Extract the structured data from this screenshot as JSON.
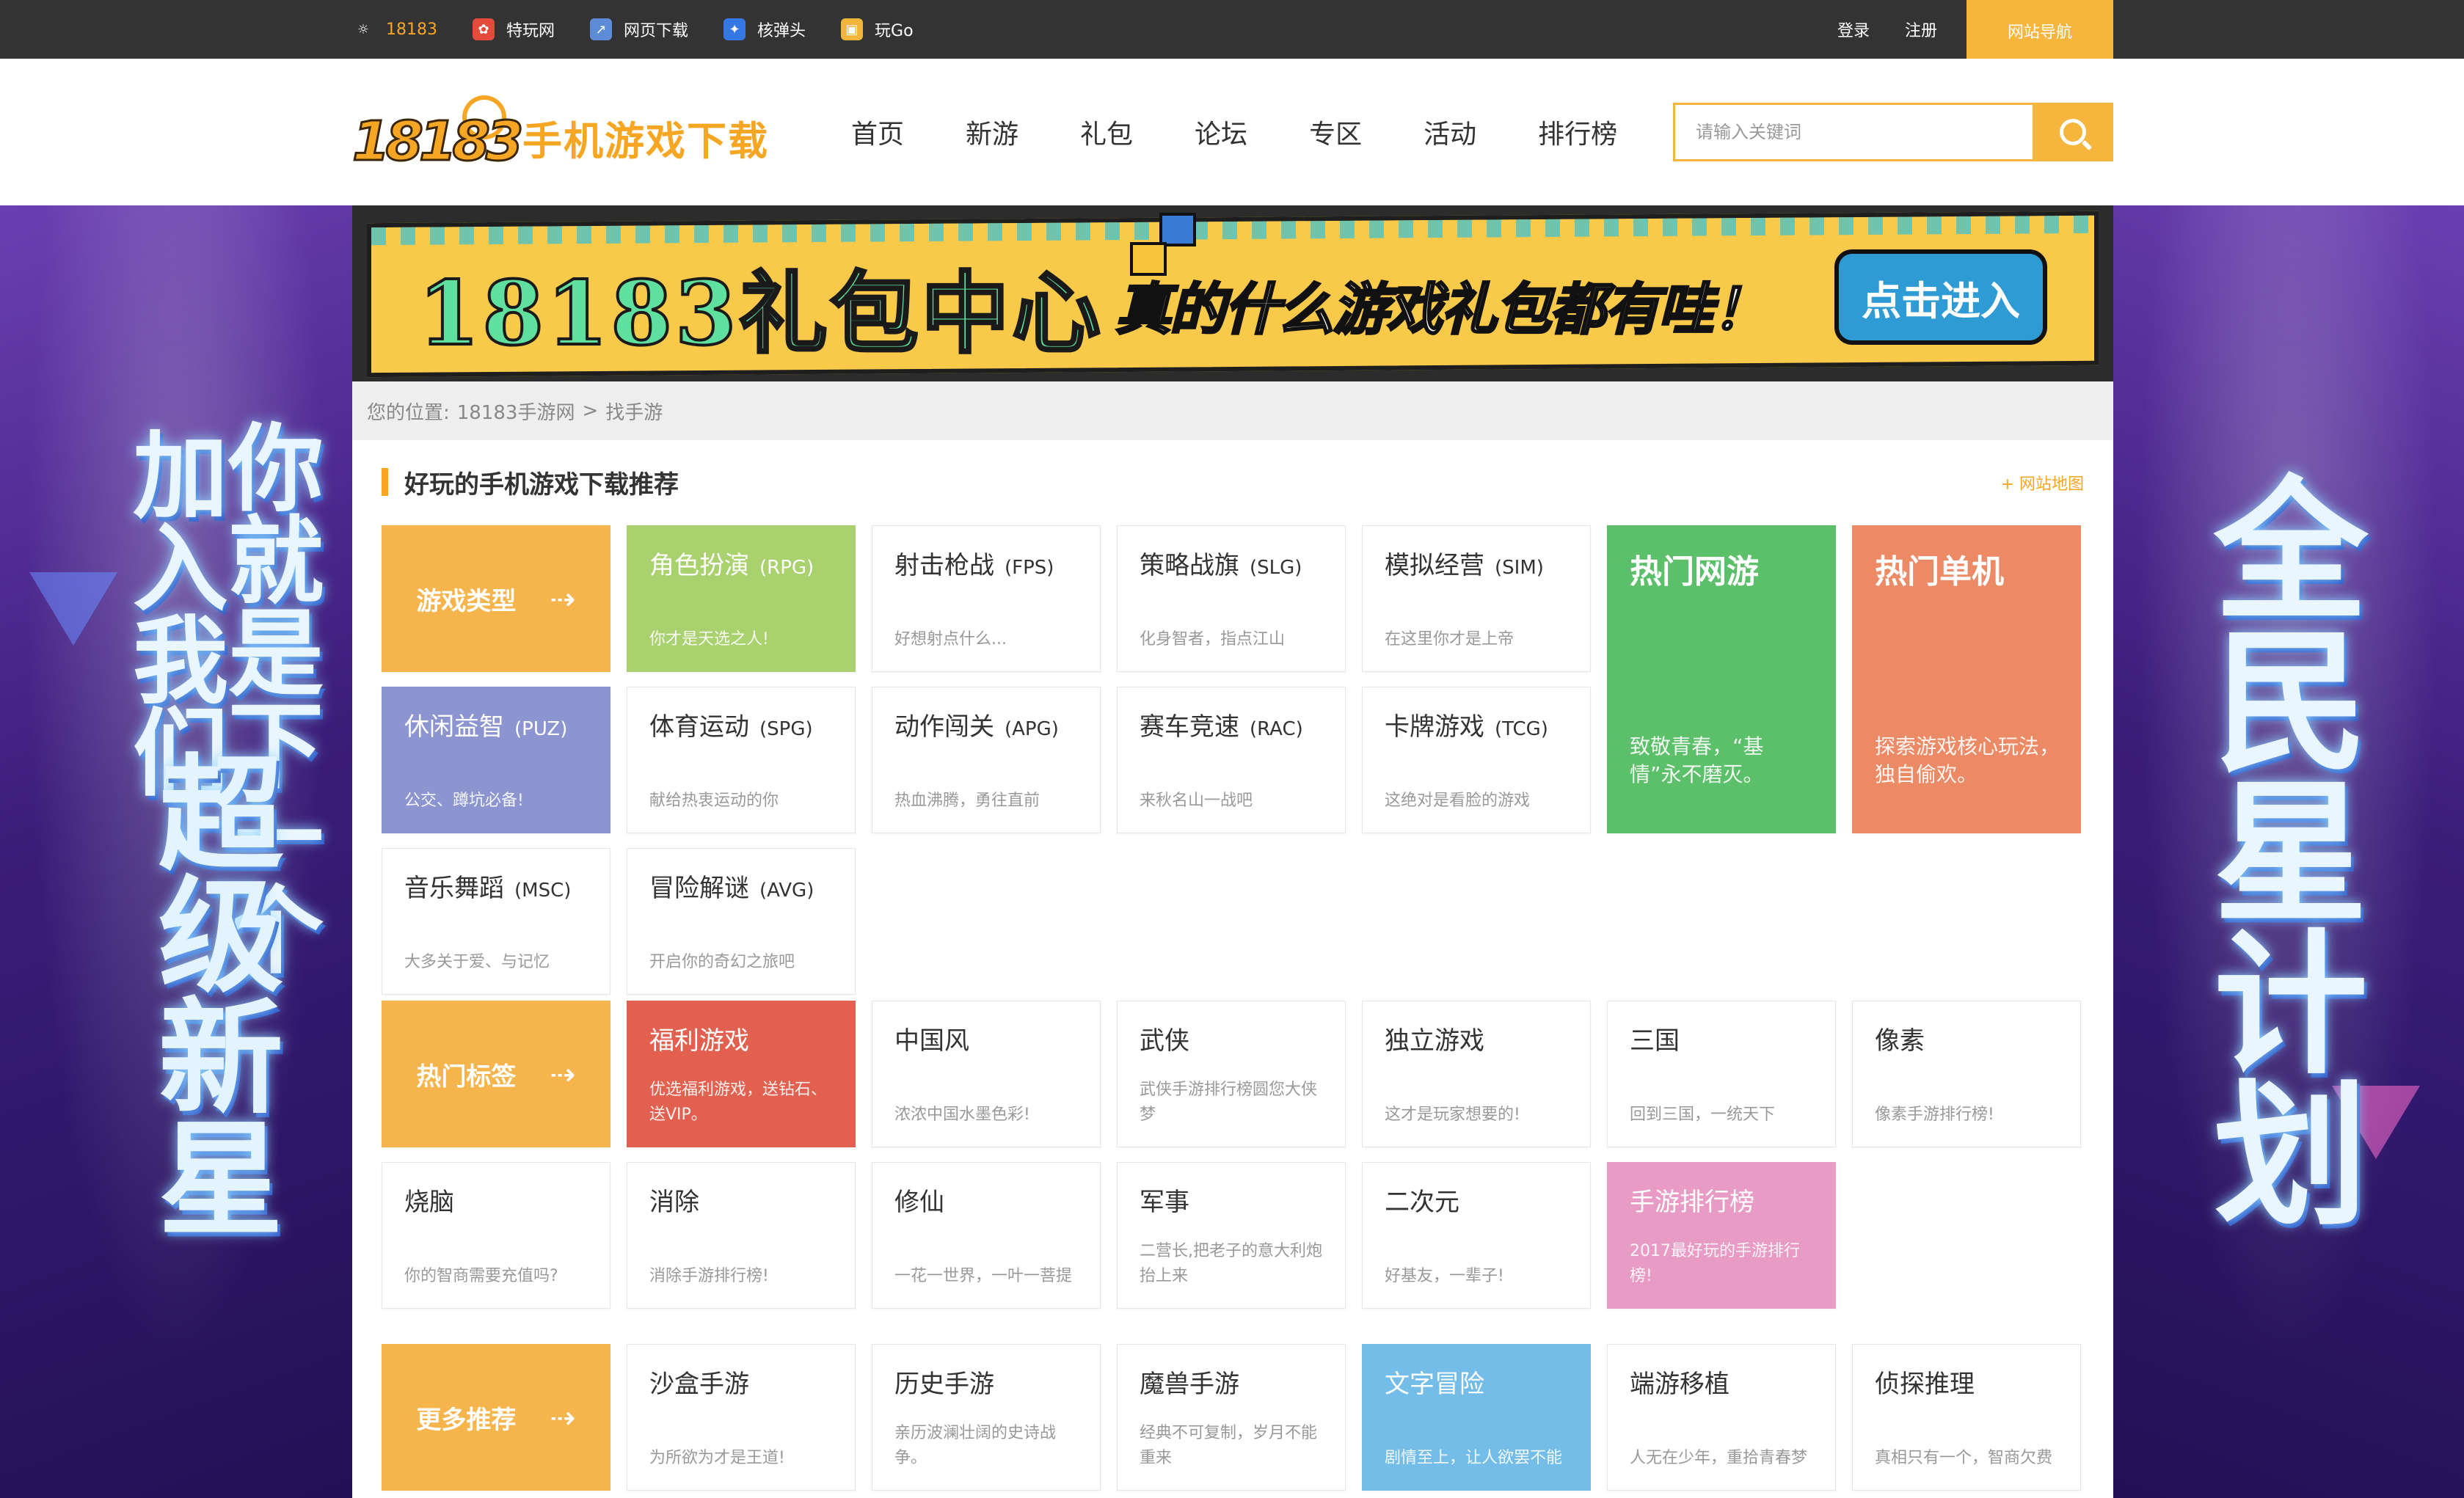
{
  "topbar": {
    "links": [
      {
        "label": "18183",
        "icon": "sun-logo-icon"
      },
      {
        "label": "特玩网",
        "icon": "tewan-icon"
      },
      {
        "label": "网页下载",
        "icon": "webpage-download-icon"
      },
      {
        "label": "核弹头",
        "icon": "hedantou-icon"
      },
      {
        "label": "玩Go",
        "icon": "wango-icon"
      }
    ],
    "login": "登录",
    "register": "注册",
    "site_nav": "网站导航"
  },
  "header": {
    "logo_text": "18183",
    "title": "手机游戏下载",
    "nav": [
      "首页",
      "新游",
      "礼包",
      "论坛",
      "专区",
      "活动",
      "排行榜"
    ],
    "search_placeholder": "请输入关键词"
  },
  "banner": {
    "title": "18183礼包中心",
    "subtitle": "真的什么游戏礼包都有哇！",
    "button": "点击进入"
  },
  "breadcrumb": {
    "prefix": "您的位置:",
    "items": [
      "18183手游网",
      ">",
      "找手游"
    ]
  },
  "section": {
    "title": "好玩的手机游戏下载推荐",
    "sitemap": "+ 网站地图"
  },
  "game_types": {
    "header": "游戏类型",
    "items": [
      {
        "name": "角色扮演",
        "abbr": "(RPG)",
        "desc": "你才是天选之人!"
      },
      {
        "name": "射击枪战",
        "abbr": "(FPS)",
        "desc": "好想射点什么..."
      },
      {
        "name": "策略战旗",
        "abbr": "(SLG)",
        "desc": "化身智者，指点江山"
      },
      {
        "name": "模拟经营",
        "abbr": "(SIM)",
        "desc": "在这里你才是上帝"
      },
      {
        "name": "休闲益智",
        "abbr": "(PUZ)",
        "desc": "公交、蹲坑必备!"
      },
      {
        "name": "体育运动",
        "abbr": "(SPG)",
        "desc": "献给热衷运动的你"
      },
      {
        "name": "动作闯关",
        "abbr": "(APG)",
        "desc": "热血沸腾，勇往直前"
      },
      {
        "name": "赛车竞速",
        "abbr": "(RAC)",
        "desc": "来秋名山一战吧"
      },
      {
        "name": "卡牌游戏",
        "abbr": "(TCG)",
        "desc": "这绝对是看脸的游戏"
      },
      {
        "name": "音乐舞蹈",
        "abbr": "(MSC)",
        "desc": "大多关于爱、与记忆"
      },
      {
        "name": "冒险解谜",
        "abbr": "(AVG)",
        "desc": "开启你的奇幻之旅吧"
      }
    ],
    "hot_online": {
      "name": "热门网游",
      "desc": "致敬青春，“基情”永不磨灭。"
    },
    "hot_single": {
      "name": "热门单机",
      "desc": "探索游戏核心玩法，独自偷欢。"
    }
  },
  "hot_tags": {
    "header": "热门标签",
    "items": [
      {
        "name": "福利游戏",
        "desc": "优选福利游戏，送钻石、送VIP。"
      },
      {
        "name": "中国风",
        "desc": "浓浓中国水墨色彩!"
      },
      {
        "name": "武侠",
        "desc": "武侠手游排行榜圆您大侠梦"
      },
      {
        "name": "独立游戏",
        "desc": "这才是玩家想要的!"
      },
      {
        "name": "三国",
        "desc": "回到三国，一统天下"
      },
      {
        "name": "像素",
        "desc": "像素手游排行榜!"
      },
      {
        "name": "烧脑",
        "desc": "你的智商需要充值吗?"
      },
      {
        "name": "消除",
        "desc": "消除手游排行榜!"
      },
      {
        "name": "修仙",
        "desc": "一花一世界，一叶一菩提"
      },
      {
        "name": "军事",
        "desc": "二营长,把老子的意大利炮抬上来"
      },
      {
        "name": "二次元",
        "desc": "好基友，一辈子!"
      },
      {
        "name": "手游排行榜",
        "desc": "2017最好玩的手游排行榜!"
      }
    ]
  },
  "more": {
    "header": "更多推荐",
    "items": [
      {
        "name": "沙盒手游",
        "desc": "为所欲为才是王道!"
      },
      {
        "name": "历史手游",
        "desc": "亲历波澜壮阔的史诗战争。"
      },
      {
        "name": "魔兽手游",
        "desc": "经典不可复制，岁月不能重来"
      },
      {
        "name": "文字冒险",
        "desc": "剧情至上，让人欲罢不能"
      },
      {
        "name": "端游移植",
        "desc": "人无在少年，重拾青春梦"
      },
      {
        "name": "侦探推理",
        "desc": "真相只有一个，智商欠费"
      }
    ]
  },
  "promo": {
    "left_col_1": "你就是下一个",
    "left_col_2": "加入我们",
    "left_col_3": "超级新星",
    "right_col": "全民星计划"
  },
  "colors": {
    "accent": "#f6a623",
    "topbar": "#333333",
    "orange_tile": "#f6b54c",
    "rpg_green": "#a9d16e",
    "puz_purple": "#8c95cf",
    "hot_online_green": "#5cbf6a",
    "hot_single_coral": "#ec8a66",
    "welfare_red": "#e1604f",
    "rank_pink": "#e89cc5",
    "text_adv_blue": "#74bde8"
  }
}
